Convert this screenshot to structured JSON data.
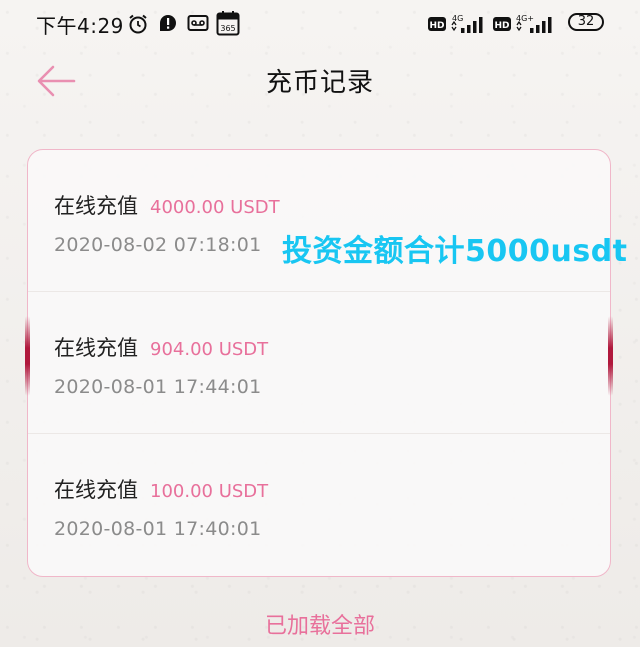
{
  "status_bar": {
    "time": "下午4:29",
    "battery": "32",
    "network_1": "4G",
    "network_2": "4G+",
    "hd_1": "HD",
    "hd_2": "HD",
    "calendar_day": "365",
    "icons": [
      "alarm-icon",
      "alert-icon",
      "voicemail-icon",
      "calendar-icon",
      "hd-icon",
      "signal-icon",
      "battery-icon"
    ]
  },
  "header": {
    "title": "充币记录",
    "back_icon": "back-arrow-icon"
  },
  "records": [
    {
      "label": "在线充值",
      "amount": "4000.00 USDT",
      "date": "2020-08-02 07:18:01"
    },
    {
      "label": "在线充值",
      "amount": "904.00 USDT",
      "date": "2020-08-01 17:44:01"
    },
    {
      "label": "在线充值",
      "amount": "100.00 USDT",
      "date": "2020-08-01 17:40:01"
    }
  ],
  "overlay_annotation": "投资金额合计5000usdt",
  "footer": "已加载全部",
  "colors": {
    "accent": "#e8709b",
    "card_border": "#f0b7c9",
    "annotation": "#18c6f2"
  }
}
